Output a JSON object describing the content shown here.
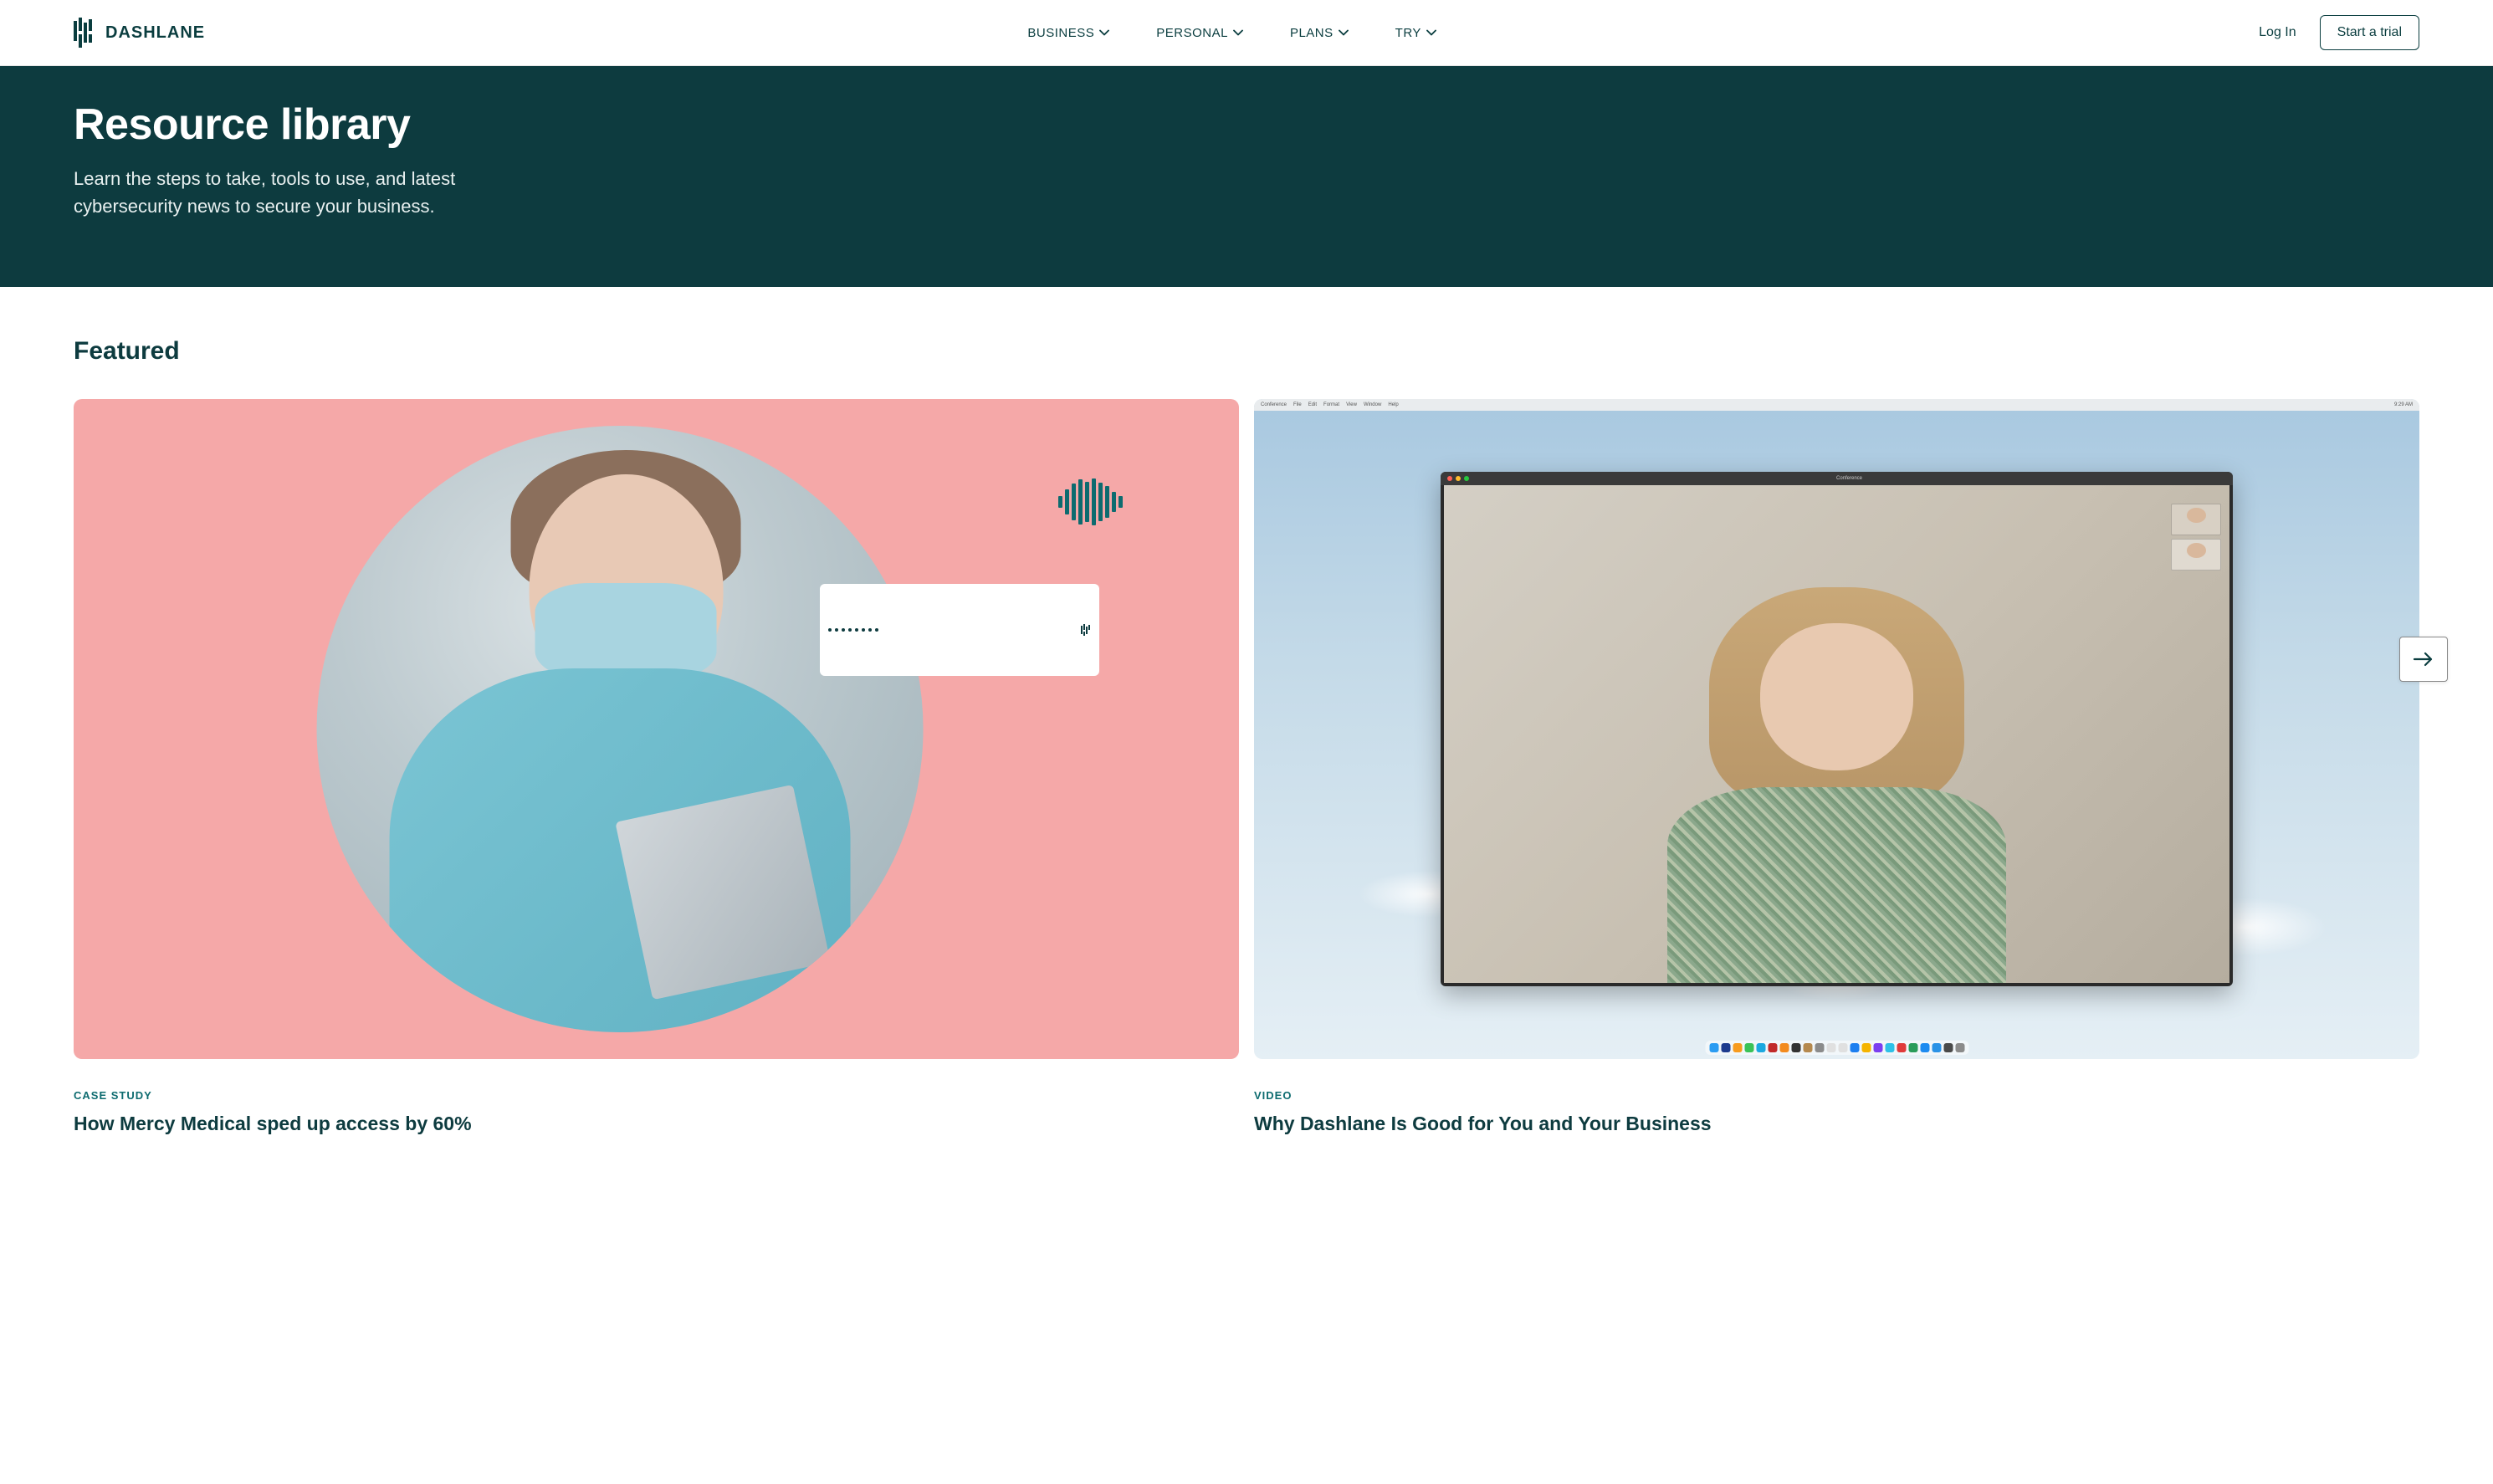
{
  "nav": {
    "brand": "DASHLANE",
    "items": [
      "BUSINESS",
      "PERSONAL",
      "PLANS",
      "TRY"
    ],
    "login": "Log In",
    "trial": "Start a trial"
  },
  "hero": {
    "title": "Resource library",
    "subtitle": "Learn the steps to take, tools to use, and latest cybersecurity news to secure your business."
  },
  "section_title": "Featured",
  "mac": {
    "menubar_left": [
      "Conference",
      "File",
      "Edit",
      "Format",
      "View",
      "Window",
      "Help"
    ],
    "menubar_time": "9:29 AM",
    "window_title": "Conference"
  },
  "dock_colors": [
    "#2b9cf2",
    "#1d3b8e",
    "#f79b1e",
    "#3ac257",
    "#1ba8e0",
    "#c12a2a",
    "#f38b1f",
    "#333333",
    "#b5894e",
    "#8b8b8b",
    "#e0e0e0",
    "#e0e0e0",
    "#1d7ff0",
    "#f5b400",
    "#7b3ff0",
    "#2ec1e8",
    "#e03a3a",
    "#2a9c5a",
    "#1d8bf0",
    "#2a92e6",
    "#4a4a4a",
    "#8b8b8b"
  ],
  "cards": [
    {
      "label": "CASE STUDY",
      "title": "How Mercy Medical sped up access by 60%"
    },
    {
      "label": "VIDEO",
      "title": "Why Dashlane Is Good for You and Your Business"
    }
  ]
}
